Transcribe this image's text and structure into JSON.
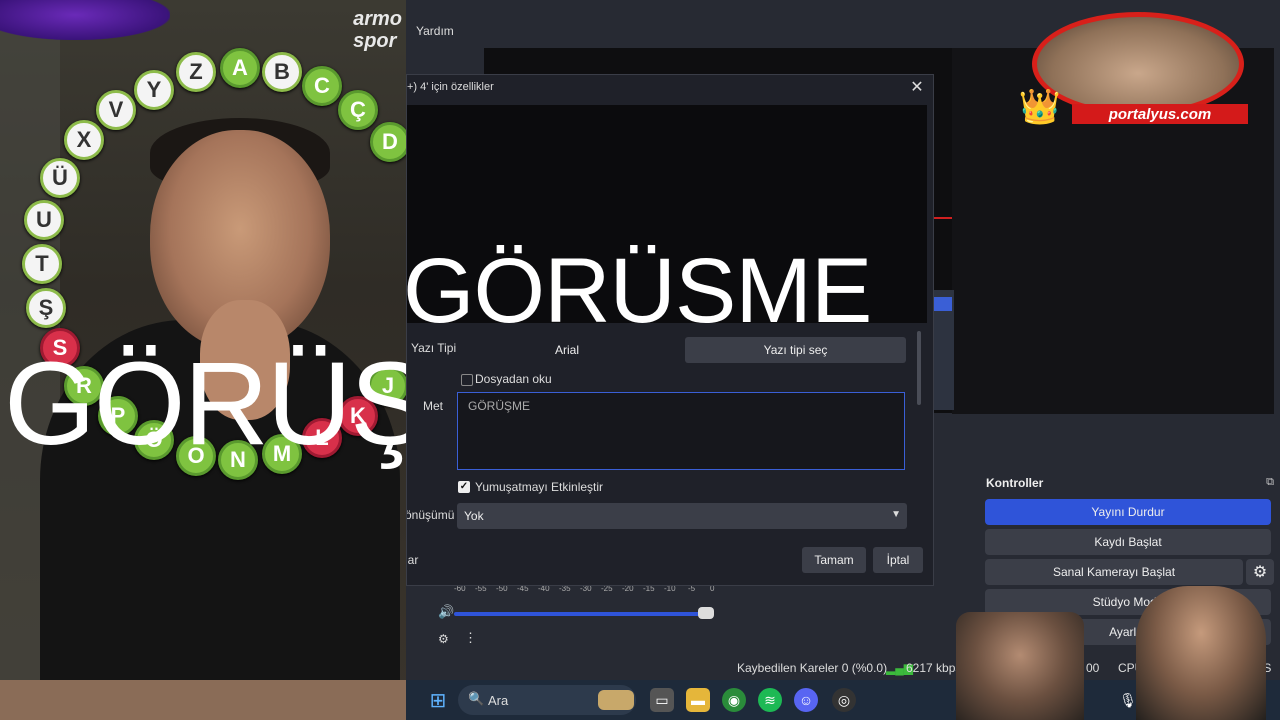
{
  "left_video": {
    "logo_line1": "armo",
    "logo_line2": "spor",
    "overlay_text": "GÖRÜŞME",
    "letters": [
      "Z",
      "A",
      "B",
      "C",
      "Ç",
      "D",
      "Y",
      "V",
      "X",
      "Ü",
      "U",
      "T",
      "Ş",
      "S",
      "R",
      "P",
      "Ö",
      "O",
      "N",
      "M",
      "L",
      "K",
      "J"
    ]
  },
  "obs": {
    "menu_help": "Yardım",
    "controls_title": "Kontroller",
    "controls": {
      "stop_stream": "Yayını Durdur",
      "start_recording": "Kaydı Başlat",
      "start_virtual_cam": "Sanal Kamerayı Başlat",
      "studio_mode": "Stüdyo Modu",
      "settings": "Ayarlar"
    },
    "mixer_scale": [
      "-60",
      "-55",
      "-50",
      "-45",
      "-40",
      "-35",
      "-30",
      "-25",
      "-20",
      "-15",
      "-10",
      "-5",
      "0"
    ],
    "status": {
      "dropped_frames": "Kaybedilen Kareler 0 (%0.0)",
      "bitrate": "6217 kbps",
      "rec_prefix": "00",
      "time_suffix": "00",
      "cpu": "CPU: 4.3%",
      "fps": "FPS"
    }
  },
  "dialog": {
    "title": "+) 4' için özellikler",
    "preview_text": "GÖRÜŞME",
    "font_label": "Yazı Tipi",
    "font_value": "Arial",
    "choose_font": "Yazı tipi seç",
    "read_from_file": "Dosyadan oku",
    "text_label": "Met",
    "text_value": "GÖRÜŞME",
    "antialias_label": "Yumuşatmayı Etkinleştir",
    "transform_label": "önüşümü",
    "transform_value": "Yok",
    "defaults_label": "lar",
    "ok": "Tamam",
    "cancel": "İptal"
  },
  "taskbar": {
    "search_placeholder": "Ara"
  },
  "webcam": {
    "brand": "portalyus.com"
  }
}
